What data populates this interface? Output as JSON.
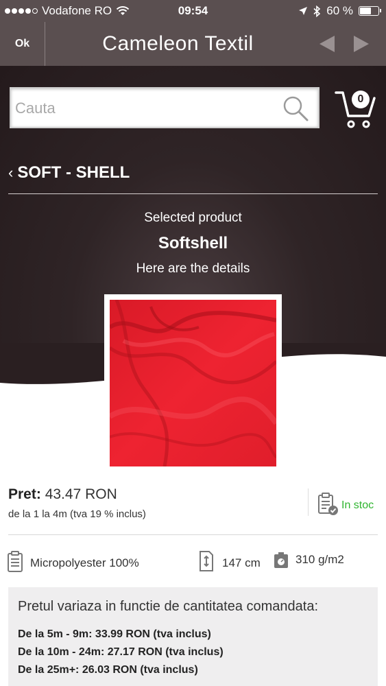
{
  "status_bar": {
    "carrier": "Vodafone RO",
    "time": "09:54",
    "battery": "60 %",
    "battery_level": 0.6
  },
  "nav": {
    "ok_label": "Ok",
    "title": "Cameleon Textil"
  },
  "search": {
    "placeholder": "Cauta"
  },
  "cart": {
    "count": "0"
  },
  "category": {
    "label": "SOFT - SHELL"
  },
  "product": {
    "selected_label": "Selected product",
    "name": "Softshell",
    "details_label": "Here are the details",
    "price_label": "Pret:",
    "price_value": "43.47 RON",
    "price_range": "de la 1 la 4m (tva 19 % inclus)",
    "stock": "In stoc",
    "composition": "Micropolyester 100%",
    "width": "147 cm",
    "weight": "310 g/m2"
  },
  "quantity_pricing": {
    "title": "Pretul variaza in functie de cantitatea comandata:",
    "tiers": [
      "De la 5m - 9m: 33.99 RON (tva inclus)",
      "De la 10m - 24m: 27.17 RON (tva inclus)",
      "De la 25m+: 26.03 RON (tva inclus)"
    ]
  },
  "colors": {
    "nav_bg": "#5a4f50",
    "hero_bg": "#2f2426",
    "fabric_red": "#e8202d",
    "stock_green": "#2fb52f"
  }
}
